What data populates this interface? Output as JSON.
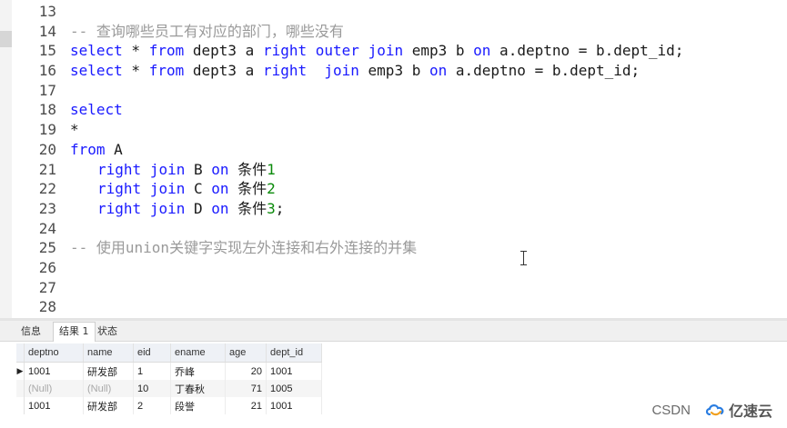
{
  "editor": {
    "line_numbers": [
      "13",
      "14",
      "15",
      "16",
      "17",
      "18",
      "19",
      "20",
      "21",
      "22",
      "23",
      "24",
      "25",
      "26",
      "27",
      "28"
    ],
    "comment1": "-- 查询哪些员工有对应的部门，哪些没有",
    "line15": {
      "kw_select": "select",
      "star_a": " * ",
      "kw_from": "from",
      "mid1": " dept3 a ",
      "kw_right": "right",
      "sp1": " ",
      "kw_outer": "outer",
      "sp2": " ",
      "kw_join": "join",
      "mid2": " emp3 b ",
      "kw_on": "on",
      "tail": " a.deptno = b.dept_id;"
    },
    "line16": {
      "kw_select": "select",
      "star_a": " * ",
      "kw_from": "from",
      "mid1": " dept3 a ",
      "kw_right": "right",
      "sp1": "  ",
      "kw_join": "join",
      "mid2": " emp3 b ",
      "kw_on": "on",
      "tail": " a.deptno = b.dept_id;"
    },
    "line18": "select",
    "line19": "*",
    "line20": {
      "kw_from": "from",
      "tail": " A"
    },
    "line21": {
      "kw_right": "right",
      "kw_join": "join",
      "table": " B ",
      "kw_on": "on",
      "cond": " 条件",
      "num": "1",
      "end": ""
    },
    "line22": {
      "kw_right": "right",
      "kw_join": "join",
      "table": " C ",
      "kw_on": "on",
      "cond": " 条件",
      "num": "2",
      "end": ""
    },
    "line23": {
      "kw_right": "right",
      "kw_join": "join",
      "table": " D ",
      "kw_on": "on",
      "cond": " 条件",
      "num": "3",
      "end": ";"
    },
    "comment2": "-- 使用union关键字实现左外连接和右外连接的并集"
  },
  "tabs": [
    {
      "label": "信息"
    },
    {
      "label": "结果 1"
    },
    {
      "label": "状态"
    }
  ],
  "results": {
    "columns": [
      "deptno",
      "name",
      "eid",
      "ename",
      "age",
      "dept_id"
    ],
    "rows": [
      {
        "deptno": "1001",
        "name": "研发部",
        "eid": "1",
        "ename": "乔峰",
        "age": "20",
        "dept_id": "1001"
      },
      {
        "deptno": "(Null)",
        "name": "(Null)",
        "eid": "10",
        "ename": "丁春秋",
        "age": "71",
        "dept_id": "1005"
      },
      {
        "deptno": "1001",
        "name": "研发部",
        "eid": "2",
        "ename": "段誉",
        "age": "21",
        "dept_id": "1001"
      }
    ],
    "current_row_marker": "▶"
  },
  "watermark": {
    "csdn": "CSDN",
    "brand": "亿速云"
  },
  "colors": {
    "keyword": "#1a1aff",
    "comment": "#9a9a9a",
    "number": "#0a8a0a",
    "null_text": "#a8a8a8"
  }
}
